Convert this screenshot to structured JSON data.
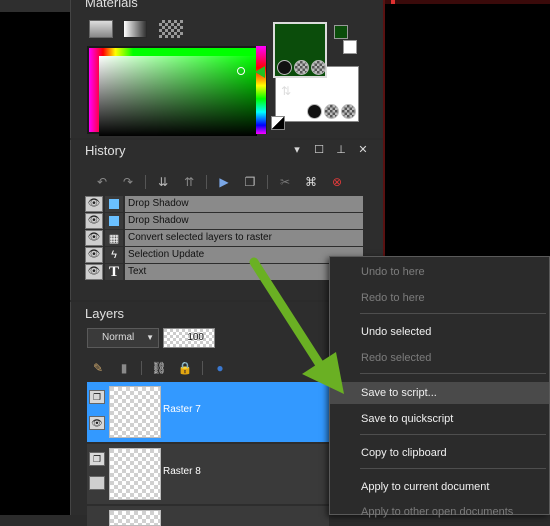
{
  "materials": {
    "title": "Materials",
    "fg_color": "#0b4d0b",
    "bg_color": "#ffffff"
  },
  "panel_buttons": {
    "menu": "▾",
    "close": "✕"
  },
  "history": {
    "title": "History",
    "items": [
      {
        "label": "Drop Shadow",
        "icon": "drop-shadow-icon"
      },
      {
        "label": "Drop Shadow",
        "icon": "drop-shadow-icon"
      },
      {
        "label": "Convert selected layers to raster",
        "icon": "raster-convert-icon"
      },
      {
        "label": "Selection Update",
        "icon": "lightning-icon"
      },
      {
        "label": "Text",
        "icon": "text-tool-icon"
      }
    ]
  },
  "layers": {
    "title": "Layers",
    "blend_mode": "Normal",
    "opacity": "100",
    "items": [
      {
        "name": "Raster 7",
        "selected": true
      },
      {
        "name": "Raster 8",
        "selected": false
      }
    ]
  },
  "context_menu": {
    "items": [
      {
        "label": "Undo to here",
        "enabled": false
      },
      {
        "label": "Redo to here",
        "enabled": false
      },
      {
        "label": "Undo selected",
        "enabled": true
      },
      {
        "label": "Redo selected",
        "enabled": false
      },
      {
        "label": "Save to script...",
        "enabled": true,
        "highlighted": true
      },
      {
        "label": "Save to quickscript",
        "enabled": true
      },
      {
        "label": "Copy to clipboard",
        "enabled": true
      },
      {
        "label": "Apply to current document",
        "enabled": true
      },
      {
        "label": "Apply to other open documents",
        "enabled": false
      }
    ]
  },
  "colors": {
    "accent_selection": "#3399ff",
    "guide_arrow": "#6ab023"
  }
}
